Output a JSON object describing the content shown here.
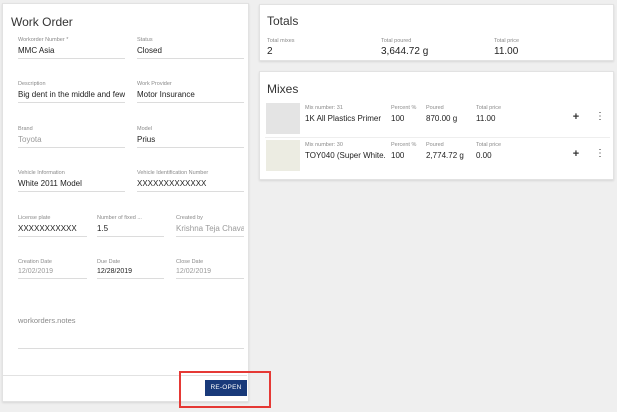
{
  "work_order": {
    "title": "Work Order",
    "fields": {
      "workorder_number": {
        "label": "Workorder Number *",
        "value": "MMC Asia"
      },
      "status": {
        "label": "Status",
        "value": "Closed"
      },
      "description": {
        "label": "Description",
        "value": "Big dent in the middle and few s"
      },
      "work_provider": {
        "label": "Work Provider",
        "value": "Motor Insurance"
      },
      "brand": {
        "label": "Brand",
        "value": "Toyota"
      },
      "model": {
        "label": "Model",
        "value": "Prius"
      },
      "vehicle_information": {
        "label": "Vehicle Information",
        "value": "White 2011 Model"
      },
      "vin": {
        "label": "Vehicle Identification Number",
        "value": "XXXXXXXXXXXXX"
      },
      "license_plate": {
        "label": "License plate",
        "value": "XXXXXXXXXXX"
      },
      "fixed_count": {
        "label": "Number of fixed ...",
        "value": "1.5"
      },
      "created_by": {
        "label": "Created by",
        "value": "Krishna Teja Chava"
      },
      "creation_date": {
        "label": "Creation Date",
        "value": "12/02/2019"
      },
      "due_date": {
        "label": "Due Date",
        "value": "12/28/2019"
      },
      "close_date": {
        "label": "Close Date",
        "value": "12/02/2019"
      }
    },
    "notes_label": "workorders.notes",
    "reopen_label": "RE-OPEN"
  },
  "totals": {
    "title": "Totals",
    "total_mixes": {
      "label": "Total mixes",
      "value": "2"
    },
    "total_poured": {
      "label": "Total poured",
      "value": "3,644.72 g"
    },
    "total_price": {
      "label": "Total price",
      "value": "11.00"
    }
  },
  "mixes": {
    "title": "Mixes",
    "items": [
      {
        "number_label": "Mix number: 31",
        "name": "1K All Plastics Primer",
        "percent_label": "Percent %",
        "percent": "100",
        "poured_label": "Poured",
        "poured": "870.00 g",
        "price_label": "Total price",
        "price": "11.00"
      },
      {
        "number_label": "Mix number: 30",
        "name": "TOY040 (Super White...",
        "percent_label": "Percent %",
        "percent": "100",
        "poured_label": "Poured",
        "poured": "2,774.72 g",
        "price_label": "Total price",
        "price": "0.00"
      }
    ],
    "plus_glyph": "+",
    "more_glyph": "⋮"
  },
  "colors": {
    "primary_button": "#193a7a",
    "highlight_border": "#e53935",
    "background": "#efefef"
  }
}
